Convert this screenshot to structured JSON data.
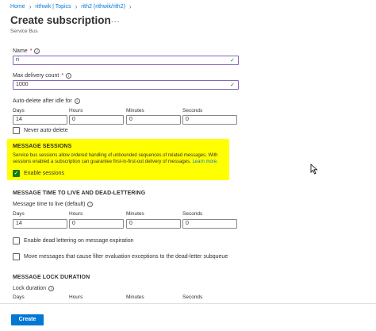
{
  "breadcrumb": [
    "Home",
    "rithwik | Topics",
    "rith2 (rithwik/rith2)"
  ],
  "page": {
    "title": "Create subscription",
    "more": "...",
    "subtitle": "Service Bus"
  },
  "fields": {
    "name_label": "Name",
    "name_value": "ri",
    "max_delivery_label": "Max delivery count",
    "max_delivery_value": "1000",
    "autodelete_label": "Auto-delete after idle for",
    "never_autodelete": "Never auto-delete"
  },
  "duration_labels": [
    "Days",
    "Hours",
    "Minutes",
    "Seconds"
  ],
  "autodelete": [
    "14",
    "0",
    "0",
    "0"
  ],
  "required_mark": "*",
  "sessions": {
    "heading": "MESSAGE SESSIONS",
    "description": "Service bus sessions allow ordered handling of unbounded sequences of related messages. With sessions enabled a subscription can guarantee first-in-first-out delivery of messages.",
    "learn_more": "Learn more.",
    "enable_label": "Enable sessions",
    "enabled": true
  },
  "ttl": {
    "heading": "MESSAGE TIME TO LIVE AND DEAD-LETTERING",
    "label": "Message time to live (default)",
    "values": [
      "14",
      "0",
      "0",
      "0"
    ],
    "deadletter_label": "Enable dead lettering on message expiration",
    "filter_label": "Move messages that cause filter evaluation exceptions to the dead-letter subqueue"
  },
  "lock": {
    "heading": "MESSAGE LOCK DURATION",
    "label": "Lock duration"
  },
  "footer": {
    "create_label": "Create"
  },
  "colors": {
    "accent": "#0078d4",
    "highlight": "#ffff00",
    "success": "#107c10",
    "focus_border": "#8764b8"
  }
}
